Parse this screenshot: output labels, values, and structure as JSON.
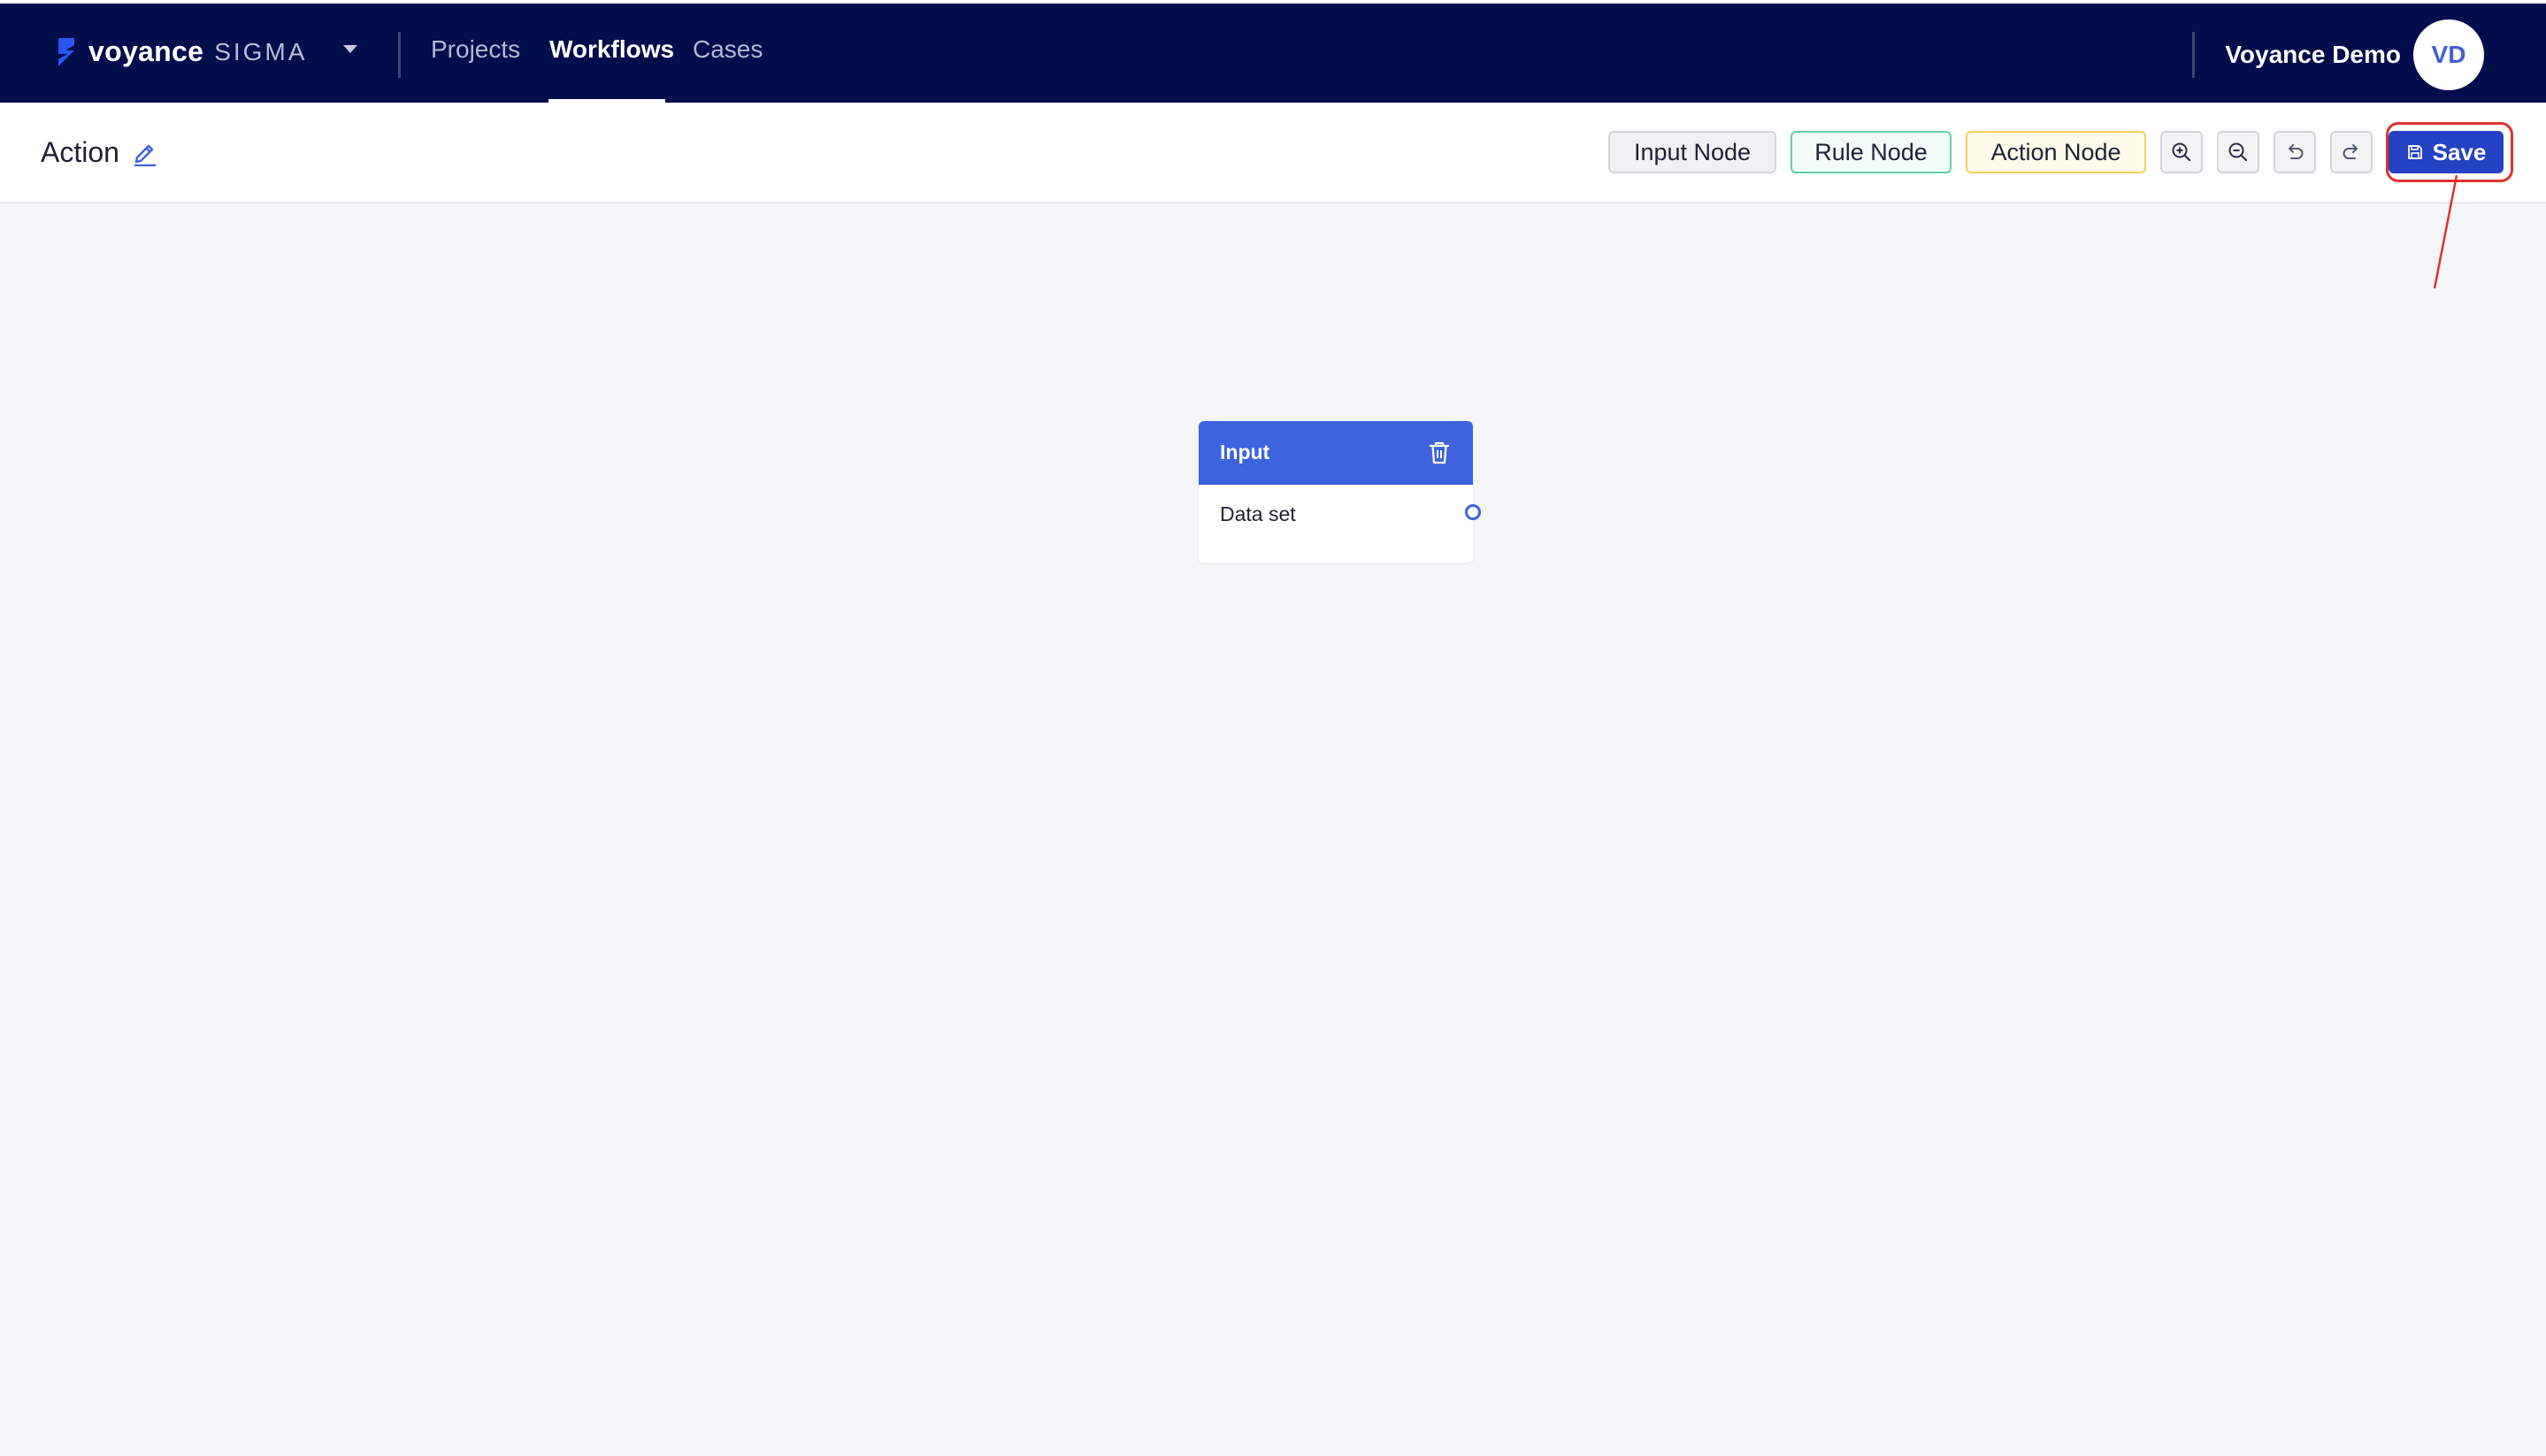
{
  "header": {
    "brand": "voyance",
    "product": "SIGMA",
    "nav": [
      "Projects",
      "Workflows",
      "Cases"
    ],
    "active_nav": "Workflows",
    "user_name": "Voyance Demo",
    "user_initials": "VD"
  },
  "toolbar": {
    "title": "Action",
    "node_buttons": {
      "input": "Input Node",
      "rule": "Rule Node",
      "action": "Action Node"
    },
    "icons": [
      "zoom-in-icon",
      "zoom-out-icon",
      "undo-icon",
      "redo-icon"
    ],
    "save_label": "Save"
  },
  "canvas": {
    "node": {
      "title": "Input",
      "field": "Data set"
    }
  },
  "colors": {
    "header_bg": "#020d4c",
    "accent": "#2541c4",
    "node_header": "#3e63de",
    "rule_border": "#62cfa8",
    "action_border": "#f2d05a",
    "annotation": "#e0312d"
  }
}
